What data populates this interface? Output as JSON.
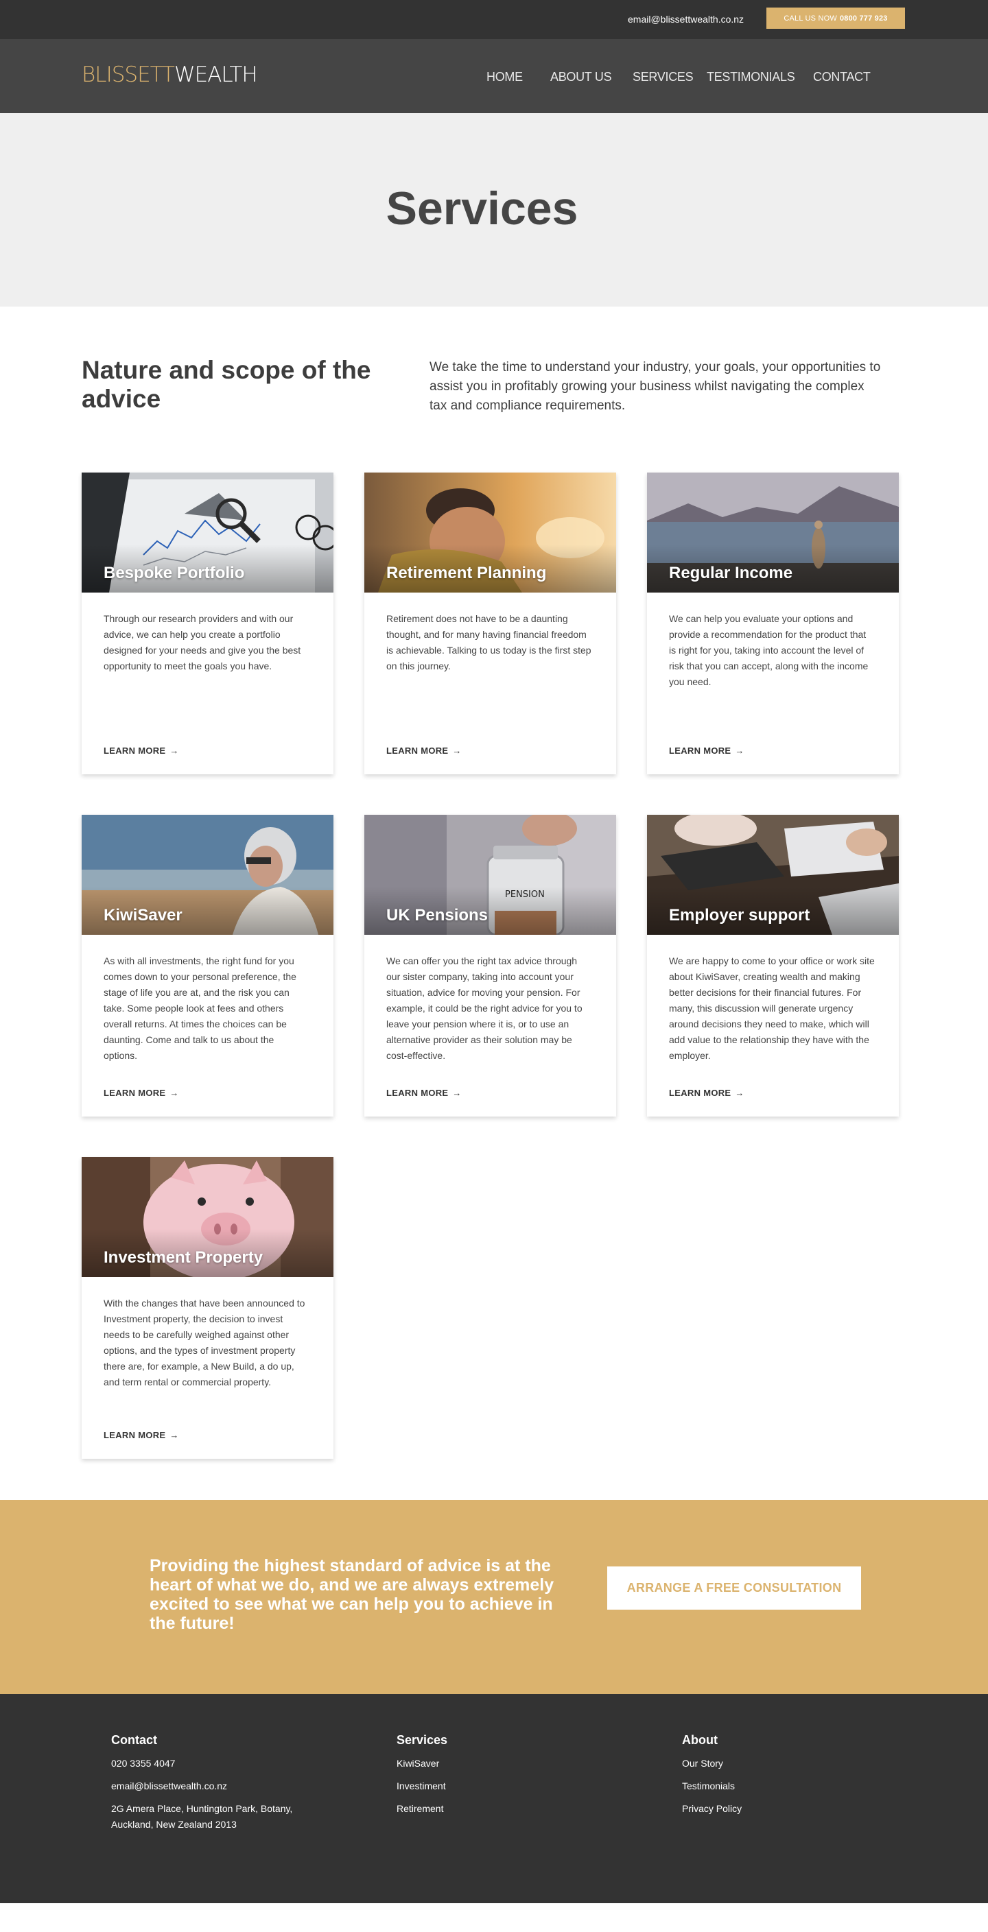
{
  "topbar": {
    "email": "email@blissettwealth.co.nz",
    "call_label": "CALL US NOW",
    "call_number": "0800 777 923"
  },
  "logo": {
    "part1": "BLISSETT",
    "part2": "WEALTH"
  },
  "nav": [
    "HOME",
    "ABOUT US",
    "SERVICES",
    "TESTIMONIALS",
    "CONTACT"
  ],
  "hero": {
    "title": "Services"
  },
  "intro": {
    "heading": "Nature and scope of the advice",
    "text": "We take the time to understand your industry, your goals, your opportunities to assist you in profitably growing your business whilst navigating the complex tax and compliance requirements."
  },
  "cards": [
    {
      "title": "Bespoke Portfolio",
      "desc": "Through our research providers and with our advice, we can help you create a portfolio designed for your needs and give you the best opportunity to meet the goals you have.",
      "more": "LEARN MORE",
      "image_icon": "chart-magnifier-image"
    },
    {
      "title": "Retirement Planning",
      "desc": "Retirement does not have to be a daunting thought, and for many having financial freedom is achievable. Talking to us today is the first step on this journey.",
      "more": "LEARN MORE",
      "image_icon": "elderly-man-sunset-image"
    },
    {
      "title": "Regular Income",
      "desc": "We can help you evaluate your options and provide a recommendation for the product that is right for you, taking into account the level of risk that you can accept, along with the income you need.",
      "more": "LEARN MORE",
      "image_icon": "lake-mountains-image"
    },
    {
      "title": "KiwiSaver",
      "desc": "As with all investments, the right fund for you comes down to your personal preference, the stage of life you are at, and the risk you can take. Some people look at fees and others overall returns. At times the choices can be daunting. Come and talk to us about the options.",
      "more": "LEARN MORE",
      "image_icon": "woman-headphones-beach-image"
    },
    {
      "title": "UK Pensions",
      "desc": "We can offer you the right tax advice through our sister company, taking into account your situation, advice for moving your pension. For example, it could be the right advice for you to leave your pension where it is, or to use an alternative provider as their solution may be cost-effective.",
      "more": "LEARN MORE",
      "image_icon": "pension-jar-image"
    },
    {
      "title": "Employer support",
      "desc": "We are happy to come to your office or work site about KiwiSaver, creating wealth and making better decisions for their financial futures. For many, this discussion will generate urgency around decisions they need to make, which will add value to the relationship they have with the employer.",
      "more": "LEARN MORE",
      "image_icon": "calculator-desk-image"
    },
    {
      "title": "Investment Property",
      "desc": "With the changes that have been announced to Investment property, the decision to invest needs to be carefully weighed against other options, and the types of investment property there are, for example, a New Build, a do up, and term rental or commercial property.",
      "more": "LEARN MORE",
      "image_icon": "piggy-bank-image"
    }
  ],
  "cta": {
    "text": "Providing the highest standard of advice is at the heart of what we do, and we are always extremely excited to see what we can help you to achieve in the future!",
    "button": "ARRANGE A FREE CONSULTATION"
  },
  "footer": {
    "contact": {
      "heading": "Contact",
      "phone": "020 3355 4047",
      "email": "email@blissettwealth.co.nz",
      "address": "2G Amera Place, Huntington Park, Botany, Auckland, New Zealand 2013"
    },
    "services": {
      "heading": "Services",
      "links": [
        "KiwiSaver",
        "Investiment",
        "Retirement"
      ]
    },
    "about": {
      "heading": "About",
      "links": [
        "Our Story",
        "Testimonials",
        "Privacy Policy"
      ]
    }
  },
  "colors": {
    "gold": "#dbb36e",
    "dark": "#333333",
    "nav": "#454545",
    "hero_bg": "#efefef"
  }
}
